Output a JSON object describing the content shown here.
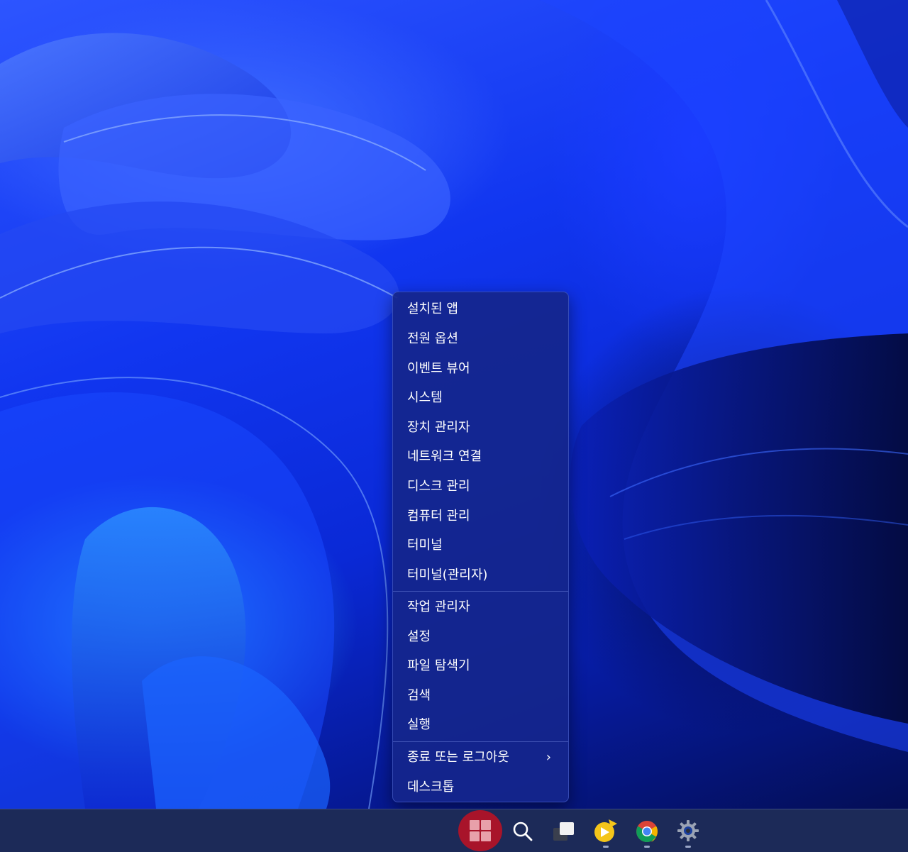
{
  "context_menu": {
    "items": [
      {
        "label": "설치된 앱"
      },
      {
        "label": "전원 옵션"
      },
      {
        "label": "이벤트 뷰어"
      },
      {
        "label": "시스템"
      },
      {
        "label": "장치 관리자"
      },
      {
        "label": "네트워크 연결"
      },
      {
        "label": "디스크 관리"
      },
      {
        "label": "컴퓨터 관리"
      },
      {
        "label": "터미널"
      },
      {
        "label": "터미널(관리자)"
      },
      {
        "label": "작업 관리자"
      },
      {
        "label": "설정"
      },
      {
        "label": "파일 탐색기"
      },
      {
        "label": "검색"
      },
      {
        "label": "실행"
      },
      {
        "label": "종료 또는 로그아웃",
        "submenu_glyph": "›"
      },
      {
        "label": "데스크톱"
      }
    ]
  },
  "taskbar": {
    "icons": [
      {
        "name": "start-icon",
        "highlighted": true,
        "highlight_color": "#a8142a"
      },
      {
        "name": "search-icon"
      },
      {
        "name": "task-view-icon"
      },
      {
        "name": "media-player-icon",
        "running": true
      },
      {
        "name": "chrome-icon",
        "running": true
      },
      {
        "name": "settings-icon",
        "running": true
      }
    ]
  },
  "colors": {
    "menu_background": "#14268c",
    "taskbar_background": "#1c2a58",
    "menu_text": "#ffffff"
  }
}
